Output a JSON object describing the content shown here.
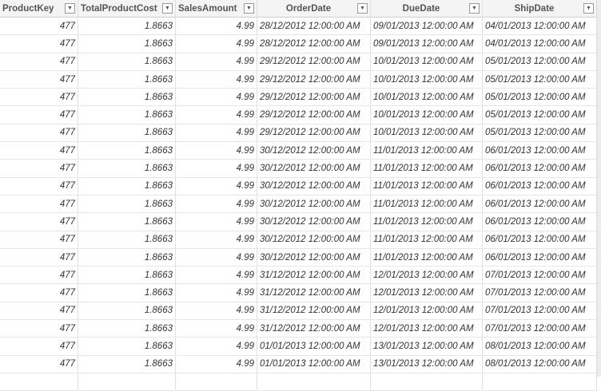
{
  "columns": [
    "ProductKey",
    "TotalProductCost",
    "SalesAmount",
    "OrderDate",
    "DueDate",
    "ShipDate"
  ],
  "rows": [
    [
      "477",
      "1.8663",
      "4.99",
      "28/12/2012 12:00:00 AM",
      "09/01/2013 12:00:00 AM",
      "04/01/2013 12:00:00 AM"
    ],
    [
      "477",
      "1.8663",
      "4.99",
      "28/12/2012 12:00:00 AM",
      "09/01/2013 12:00:00 AM",
      "04/01/2013 12:00:00 AM"
    ],
    [
      "477",
      "1.8663",
      "4.99",
      "29/12/2012 12:00:00 AM",
      "10/01/2013 12:00:00 AM",
      "05/01/2013 12:00:00 AM"
    ],
    [
      "477",
      "1.8663",
      "4.99",
      "29/12/2012 12:00:00 AM",
      "10/01/2013 12:00:00 AM",
      "05/01/2013 12:00:00 AM"
    ],
    [
      "477",
      "1.8663",
      "4.99",
      "29/12/2012 12:00:00 AM",
      "10/01/2013 12:00:00 AM",
      "05/01/2013 12:00:00 AM"
    ],
    [
      "477",
      "1.8663",
      "4.99",
      "29/12/2012 12:00:00 AM",
      "10/01/2013 12:00:00 AM",
      "05/01/2013 12:00:00 AM"
    ],
    [
      "477",
      "1.8663",
      "4.99",
      "29/12/2012 12:00:00 AM",
      "10/01/2013 12:00:00 AM",
      "05/01/2013 12:00:00 AM"
    ],
    [
      "477",
      "1.8663",
      "4.99",
      "30/12/2012 12:00:00 AM",
      "11/01/2013 12:00:00 AM",
      "06/01/2013 12:00:00 AM"
    ],
    [
      "477",
      "1.8663",
      "4.99",
      "30/12/2012 12:00:00 AM",
      "11/01/2013 12:00:00 AM",
      "06/01/2013 12:00:00 AM"
    ],
    [
      "477",
      "1.8663",
      "4.99",
      "30/12/2012 12:00:00 AM",
      "11/01/2013 12:00:00 AM",
      "06/01/2013 12:00:00 AM"
    ],
    [
      "477",
      "1.8663",
      "4.99",
      "30/12/2012 12:00:00 AM",
      "11/01/2013 12:00:00 AM",
      "06/01/2013 12:00:00 AM"
    ],
    [
      "477",
      "1.8663",
      "4.99",
      "30/12/2012 12:00:00 AM",
      "11/01/2013 12:00:00 AM",
      "06/01/2013 12:00:00 AM"
    ],
    [
      "477",
      "1.8663",
      "4.99",
      "30/12/2012 12:00:00 AM",
      "11/01/2013 12:00:00 AM",
      "06/01/2013 12:00:00 AM"
    ],
    [
      "477",
      "1.8663",
      "4.99",
      "30/12/2012 12:00:00 AM",
      "11/01/2013 12:00:00 AM",
      "06/01/2013 12:00:00 AM"
    ],
    [
      "477",
      "1.8663",
      "4.99",
      "31/12/2012 12:00:00 AM",
      "12/01/2013 12:00:00 AM",
      "07/01/2013 12:00:00 AM"
    ],
    [
      "477",
      "1.8663",
      "4.99",
      "31/12/2012 12:00:00 AM",
      "12/01/2013 12:00:00 AM",
      "07/01/2013 12:00:00 AM"
    ],
    [
      "477",
      "1.8663",
      "4.99",
      "31/12/2012 12:00:00 AM",
      "12/01/2013 12:00:00 AM",
      "07/01/2013 12:00:00 AM"
    ],
    [
      "477",
      "1.8663",
      "4.99",
      "31/12/2012 12:00:00 AM",
      "12/01/2013 12:00:00 AM",
      "07/01/2013 12:00:00 AM"
    ],
    [
      "477",
      "1.8663",
      "4.99",
      "01/01/2013 12:00:00 AM",
      "13/01/2013 12:00:00 AM",
      "08/01/2013 12:00:00 AM"
    ],
    [
      "477",
      "1.8663",
      "4.99",
      "01/01/2013 12:00:00 AM",
      "13/01/2013 12:00:00 AM",
      "08/01/2013 12:00:00 AM"
    ]
  ],
  "filter_icon": "▼"
}
